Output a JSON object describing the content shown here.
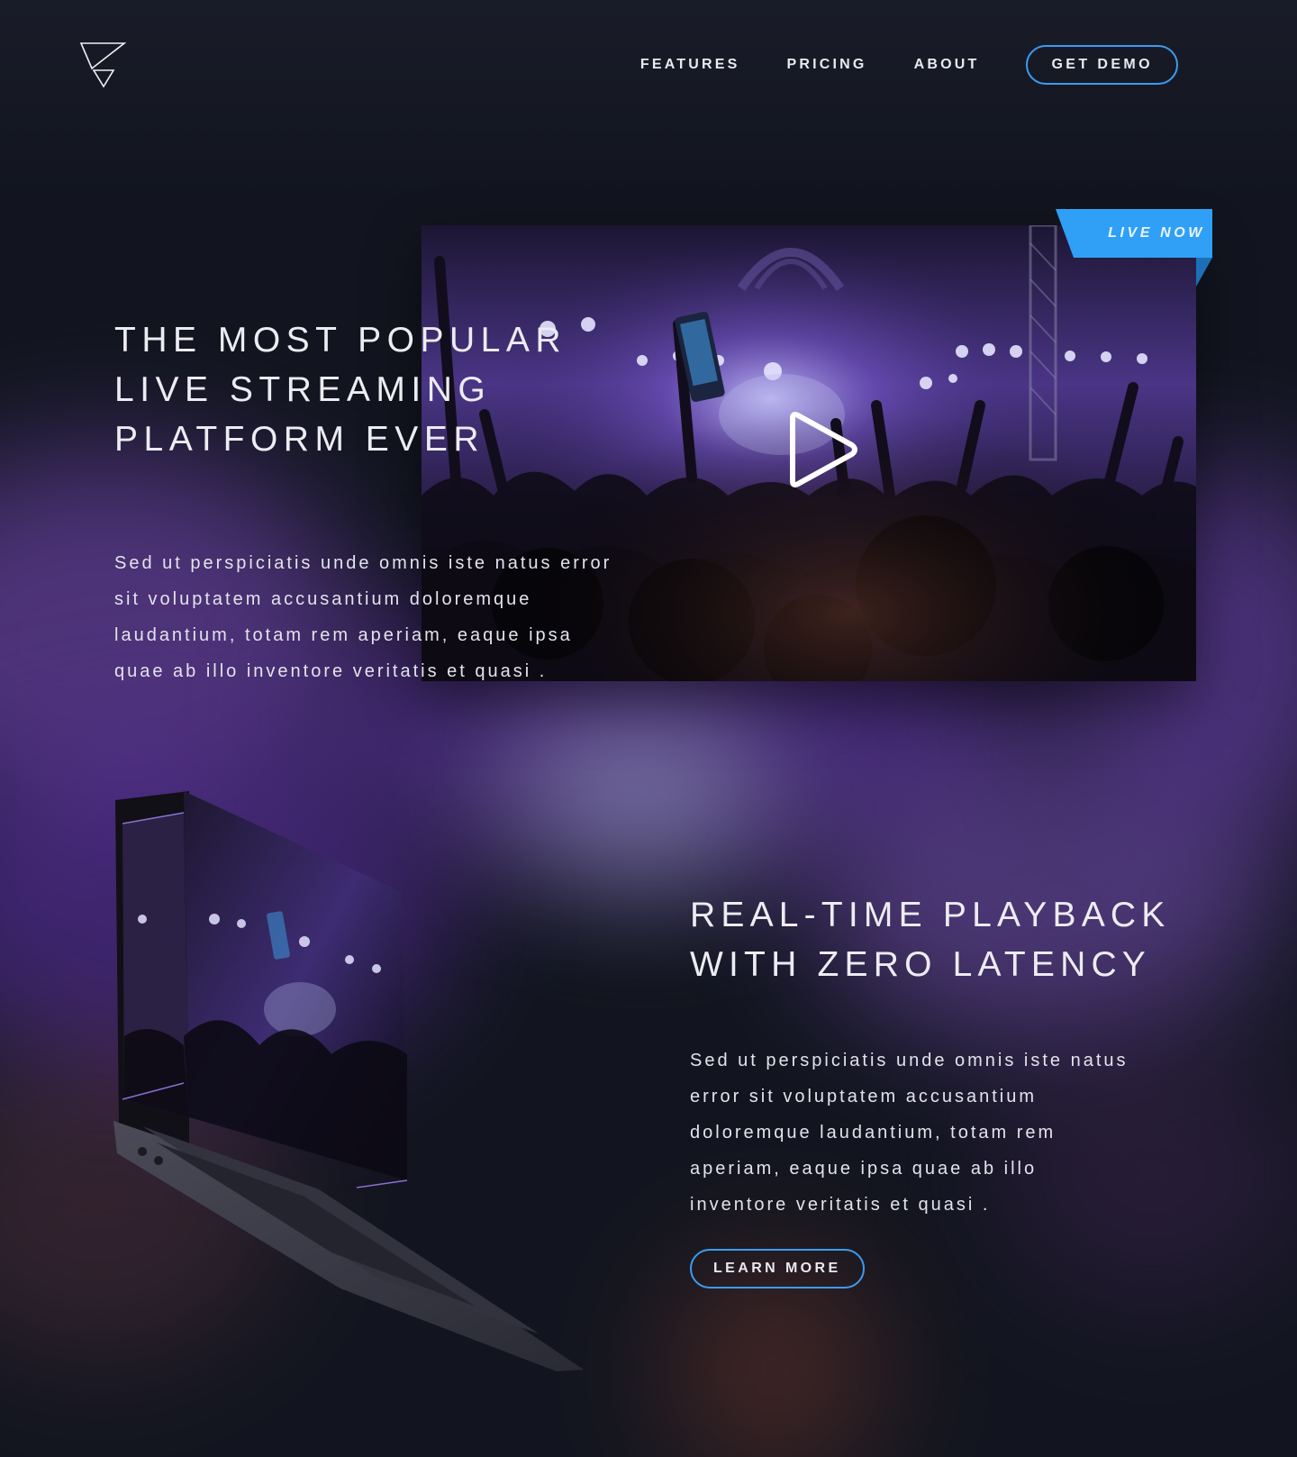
{
  "nav": {
    "links": [
      "FEATURES",
      "PRICING",
      "ABOUT"
    ],
    "cta": "GET DEMO"
  },
  "hero": {
    "badge": "LIVE NOW",
    "title_lines": [
      "THE MOST POPULAR",
      "LIVE STREAMING",
      "PLATFORM EVER"
    ],
    "body": "Sed ut perspiciatis unde omnis iste natus error sit voluptatem accusantium doloremque laudantium, totam rem aperiam, eaque ipsa quae ab illo inventore veritatis et quasi ."
  },
  "feature": {
    "title_lines": [
      "REAL-TIME PLAYBACK",
      "WITH ZERO LATENCY"
    ],
    "body": "Sed ut perspiciatis unde omnis iste natus error sit voluptatem accusantium doloremque laudantium, totam rem aperiam, eaque ipsa quae ab illo inventore veritatis et quasi .",
    "cta": "LEARN MORE"
  },
  "colors": {
    "accent": "#3b9cf0",
    "badge": "#2fa0f5",
    "background": "#12151f",
    "glow_purple": "#6a3aa8"
  },
  "icons": {
    "logo": "triangle-logo-icon",
    "play": "play-icon"
  }
}
